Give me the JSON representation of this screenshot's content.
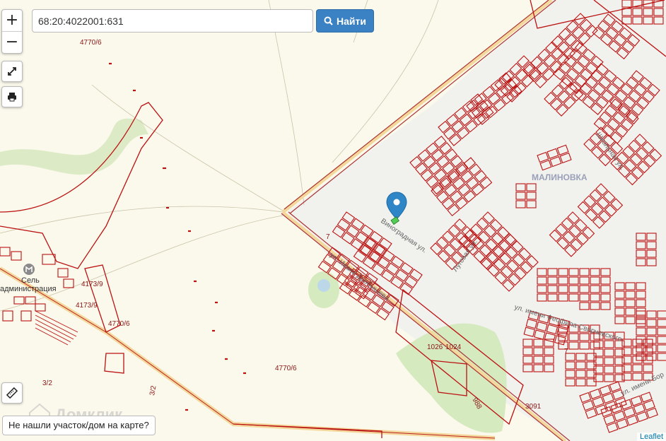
{
  "search": {
    "value": "68:20:4022001:631",
    "button_label": "Найти"
  },
  "zoom": {
    "in_label": "+",
    "out_label": "−"
  },
  "not_found_label": "Не нашли участок/дом на карте?",
  "attribution": "Leaflet",
  "watermark": "Домклик",
  "map": {
    "place_name": "МАЛИНОВКА",
    "settlement_admin": [
      "Сель",
      "администрация"
    ],
    "streets": [
      "Виноградная ул.",
      "Школьная ул.",
      "Луговая ул.",
      "ул. имени Феофила Свирчевского",
      "ул. Ивана Дробышева",
      "ул. имени Бор"
    ],
    "parcel_labels": [
      "4770/6",
      "4770/6",
      "4770/6",
      "4173/9",
      "4173/9",
      "3/2",
      "3/2",
      "7",
      "7",
      "1026",
      "1024",
      "988",
      "3091"
    ]
  }
}
